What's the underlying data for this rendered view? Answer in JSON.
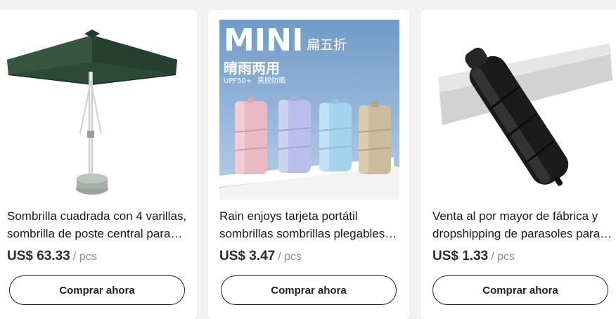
{
  "products": [
    {
      "title": "Sombrilla cuadrada con 4 varillas, sombrilla de poste central para…",
      "price": "US$ 63.33",
      "unit": "/ pcs",
      "button": "Comprar ahora",
      "image_icon": "patio-umbrella-image"
    },
    {
      "title": "Rain enjoys tarjeta portátil sombrillas sombrillas plegables…",
      "price": "US$ 3.47",
      "unit": "/ pcs",
      "button": "Comprar ahora",
      "image_icon": "mini-umbrellas-image",
      "image_text": {
        "headline": "MINI",
        "discount": "扁五折",
        "subtitle": "晴雨两用",
        "tagline_left": "UPF50+",
        "tagline_right": "黑胶防晒"
      }
    },
    {
      "title": "Venta al por mayor de fábrica y dropshipping de parasoles para…",
      "price": "US$ 1.33",
      "unit": "/ pcs",
      "button": "Comprar ahora",
      "image_icon": "black-umbrella-image"
    }
  ],
  "colors": {
    "page_bg": "#f2f2f2",
    "card_bg": "#ffffff",
    "text": "#191919",
    "unit": "#8c8c8c",
    "canopy_green": "#2c4a36",
    "banner_blue": "#6f9ac9"
  }
}
